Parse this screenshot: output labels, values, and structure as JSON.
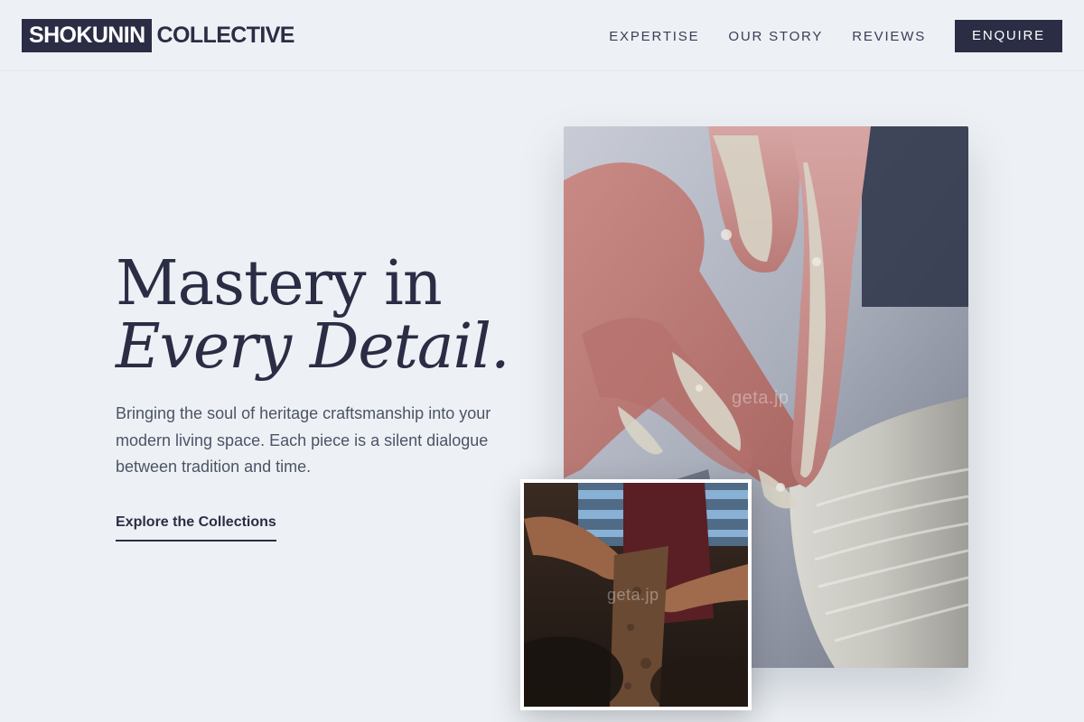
{
  "header": {
    "logo_primary": "SHOKUNIN",
    "logo_secondary": "COLLECTIVE",
    "nav": [
      {
        "label": "EXPERTISE"
      },
      {
        "label": "OUR STORY"
      },
      {
        "label": "REVIEWS"
      }
    ],
    "cta_label": "ENQUIRE"
  },
  "hero": {
    "title_line1": "Mastery in",
    "title_line2": "Every Detail.",
    "description": "Bringing the soul of heritage craftsmanship into your modern living space. Each piece is a silent dialogue between tradition and time.",
    "link_label": "Explore the Collections"
  },
  "images": {
    "main": {
      "watermark": "geta.jp"
    },
    "inset": {
      "watermark": "geta.jp"
    }
  },
  "colors": {
    "background": "#edf1f5",
    "brand": "#2b2d45",
    "body_text": "#4c5366"
  }
}
